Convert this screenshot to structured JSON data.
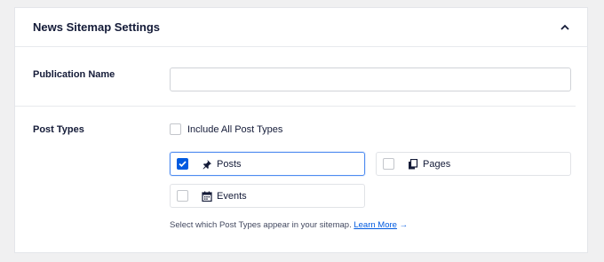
{
  "panel": {
    "title": "News Sitemap Settings"
  },
  "publication_name": {
    "label": "Publication Name",
    "value": "",
    "placeholder": ""
  },
  "post_types": {
    "label": "Post Types",
    "include_all": {
      "label": "Include All Post Types",
      "checked": false
    },
    "options": [
      {
        "label": "Posts",
        "icon": "pin-icon",
        "checked": true
      },
      {
        "label": "Pages",
        "icon": "pages-icon",
        "checked": false
      },
      {
        "label": "Events",
        "icon": "calendar-icon",
        "checked": false
      }
    ],
    "help_text": "Select which Post Types appear in your sitemap.",
    "help_link": "Learn More",
    "help_arrow": "→"
  },
  "colors": {
    "accent": "#005ae0",
    "selected_border": "#4f8cf0",
    "text": "#141b38"
  }
}
